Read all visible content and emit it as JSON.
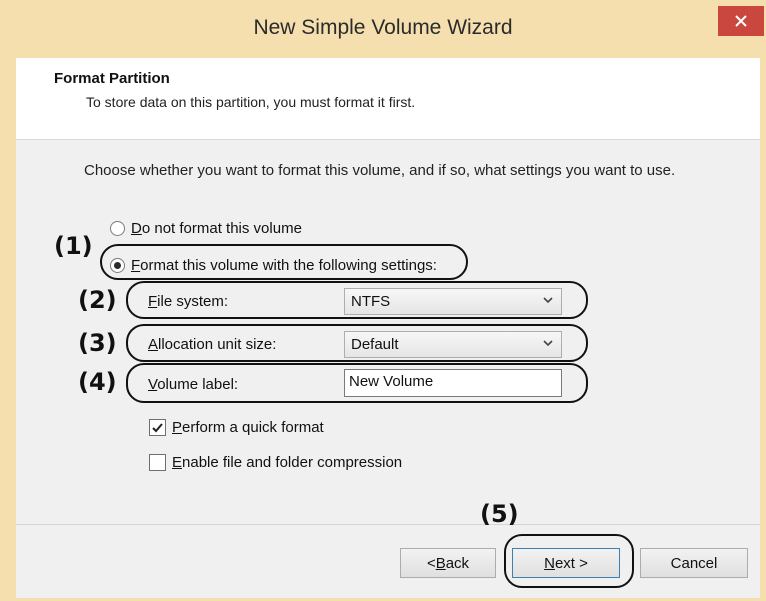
{
  "window": {
    "title": "New Simple Volume Wizard",
    "close_glyph": "close-icon"
  },
  "header": {
    "title": "Format Partition",
    "subtitle": "To store data on this partition, you must format it first."
  },
  "instruction": "Choose whether you want to format this volume, and if so, what settings you want to use.",
  "options": {
    "do_not_format": {
      "prefix": "",
      "accel": "D",
      "rest": "o not format this volume",
      "checked": false
    },
    "format_with": {
      "prefix": "",
      "accel": "F",
      "rest": "ormat this volume with the following settings:",
      "checked": true
    }
  },
  "fields": {
    "file_system": {
      "label_accel": "F",
      "label_rest": "ile system:",
      "value": "NTFS"
    },
    "allocation_unit_size": {
      "label_accel": "A",
      "label_rest": "llocation unit size:",
      "value": "Default"
    },
    "volume_label": {
      "label_accel": "V",
      "label_rest": "olume label:",
      "value": "New Volume"
    }
  },
  "checkboxes": {
    "quick_format": {
      "accel": "P",
      "rest": "erform a quick format",
      "checked": true
    },
    "compression": {
      "accel": "E",
      "rest": "nable file and folder compression",
      "checked": false
    }
  },
  "buttons": {
    "back": {
      "pre": "< ",
      "accel": "B",
      "rest": "ack"
    },
    "next": {
      "pre": "",
      "accel": "N",
      "rest": "ext >"
    },
    "cancel": "Cancel"
  },
  "annotations": [
    "(1)",
    "(2)",
    "(3)",
    "(4)",
    "(5)"
  ],
  "colors": {
    "title_bar": "#f5dfae",
    "close_button": "#c9473e",
    "dialog_bg": "#f0f0f0"
  }
}
